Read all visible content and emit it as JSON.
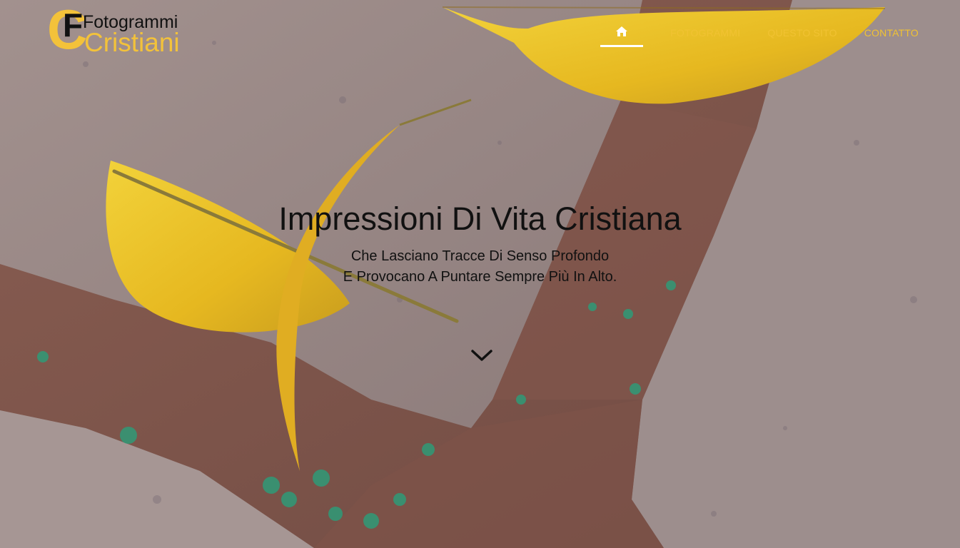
{
  "logo": {
    "line1": "Fotogrammi",
    "line2": "Cristiani",
    "monogram_c": "C",
    "monogram_f": "F"
  },
  "nav": {
    "home_icon": "home-icon",
    "items": [
      {
        "label": "FOTOGRAMMI"
      },
      {
        "label": "QUESTO SITO"
      },
      {
        "label": "CONTATTO"
      }
    ],
    "active": "home"
  },
  "hero": {
    "title": "Impressioni Di Vita Cristiana",
    "subtitle_line1": "Che Lasciano Tracce Di Senso Profondo",
    "subtitle_line2": "E Provocano A Puntare Sempre Più In Alto.",
    "scroll_icon": "chevron-down-icon"
  },
  "colors": {
    "accent": "#f1c232",
    "text": "#111111",
    "active_underline": "#ffffff"
  }
}
